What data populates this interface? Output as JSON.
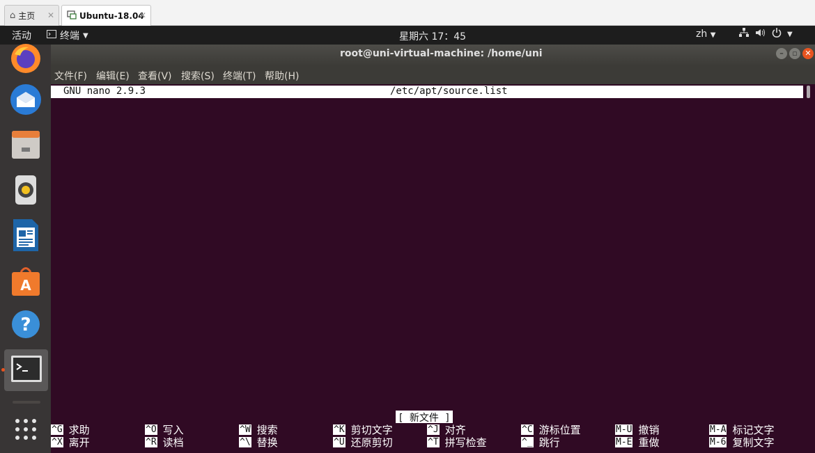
{
  "host_tabs": [
    {
      "label": "主页",
      "close": "✕"
    },
    {
      "label": "Ubuntu-18.04",
      "close": "✕"
    }
  ],
  "topbar": {
    "activities": "活动",
    "app_menu": "终端",
    "clock": "星期六 17：45",
    "language": "zh"
  },
  "window": {
    "title": "root@uni-virtual-machine: /home/uni"
  },
  "menu": [
    "文件(F)",
    "编辑(E)",
    "查看(V)",
    "搜索(S)",
    "终端(T)",
    "帮助(H)"
  ],
  "nano": {
    "version": "GNU nano 2.9.3",
    "filename": "/etc/apt/source.list",
    "status": "[ 新文件 ]",
    "shortcuts": [
      {
        "key": "^G",
        "label": "求助"
      },
      {
        "key": "^X",
        "label": "离开"
      },
      {
        "key": "^O",
        "label": "写入"
      },
      {
        "key": "^R",
        "label": "读档"
      },
      {
        "key": "^W",
        "label": "搜索"
      },
      {
        "key": "^\\",
        "label": "替换"
      },
      {
        "key": "^K",
        "label": "剪切文字"
      },
      {
        "key": "^U",
        "label": "还原剪切"
      },
      {
        "key": "^J",
        "label": "对齐"
      },
      {
        "key": "^T",
        "label": "拼写检查"
      },
      {
        "key": "^C",
        "label": "游标位置"
      },
      {
        "key": "^_",
        "label": "跳行"
      },
      {
        "key": "M-U",
        "label": "撤销"
      },
      {
        "key": "M-E",
        "label": "重做"
      },
      {
        "key": "M-A",
        "label": "标记文字"
      },
      {
        "key": "M-6",
        "label": "复制文字"
      }
    ]
  },
  "dock": [
    {
      "icon": "firefox-icon"
    },
    {
      "icon": "thunderbird-icon"
    },
    {
      "icon": "files-icon"
    },
    {
      "icon": "rhythmbox-icon"
    },
    {
      "icon": "libreoffice-writer-icon"
    },
    {
      "icon": "software-center-icon"
    },
    {
      "icon": "help-icon"
    },
    {
      "icon": "terminal-icon",
      "running": true
    },
    {
      "icon": "app-grid-icon"
    }
  ],
  "colors": {
    "terminal_bg": "#300a24",
    "accent": "#e95420",
    "dock_bg": "#383535",
    "topbar_bg": "#1d1d1d"
  }
}
